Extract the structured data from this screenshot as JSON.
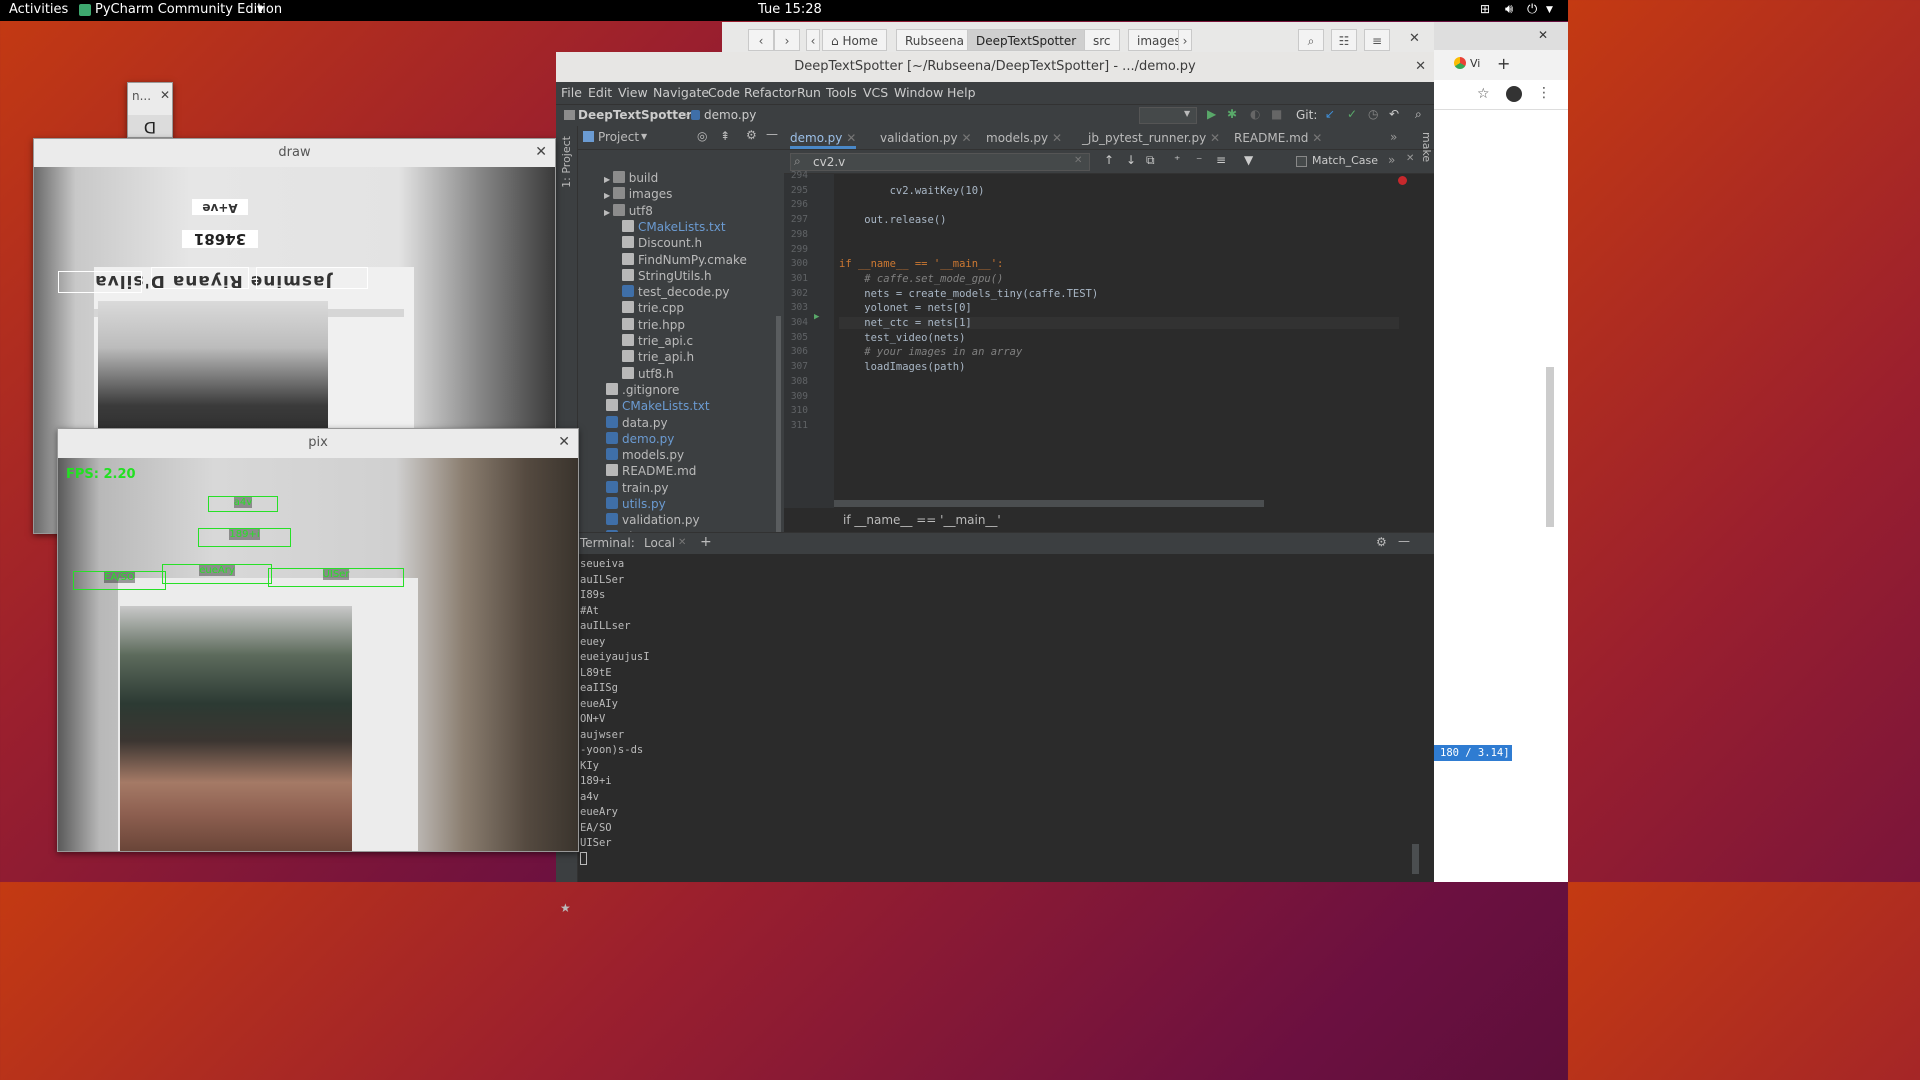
{
  "topbar": {
    "activities": "Activities",
    "app": "PyCharm Community Edition",
    "clock": "Tue 15:28"
  },
  "files": {
    "crumbs": [
      "Home",
      "Rubseena",
      "DeepTextSpotter",
      "src",
      "images"
    ]
  },
  "pycharm": {
    "title": "DeepTextSpotter [~/Rubseena/DeepTextSpotter] - .../demo.py",
    "menu": [
      "File",
      "Edit",
      "View",
      "Navigate",
      "Code",
      "Refactor",
      "Run",
      "Tools",
      "VCS",
      "Window",
      "Help"
    ],
    "nav": {
      "project": "DeepTextSpotter",
      "file": "demo.py",
      "git": "Git:"
    },
    "project_label": "Project",
    "side_label": "1: Project",
    "tree": [
      {
        "label": "build",
        "type": "folder"
      },
      {
        "label": "images",
        "type": "folder"
      },
      {
        "label": "utf8",
        "type": "folder"
      },
      {
        "label": "CMakeLists.txt",
        "type": "txt",
        "blue": true
      },
      {
        "label": "Discount.h",
        "type": "txt"
      },
      {
        "label": "FindNumPy.cmake",
        "type": "txt"
      },
      {
        "label": "StringUtils.h",
        "type": "txt"
      },
      {
        "label": "test_decode.py",
        "type": "py"
      },
      {
        "label": "trie.cpp",
        "type": "txt"
      },
      {
        "label": "trie.hpp",
        "type": "txt"
      },
      {
        "label": "trie_api.c",
        "type": "txt"
      },
      {
        "label": "trie_api.h",
        "type": "txt"
      },
      {
        "label": "utf8.h",
        "type": "txt"
      },
      {
        "label": ".gitignore",
        "type": "txt"
      },
      {
        "label": "CMakeLists.txt",
        "type": "txt",
        "blue": true
      },
      {
        "label": "data.py",
        "type": "py"
      },
      {
        "label": "demo.py",
        "type": "py",
        "blue": true
      },
      {
        "label": "models.py",
        "type": "py"
      },
      {
        "label": "README.md",
        "type": "txt"
      },
      {
        "label": "train.py",
        "type": "py"
      },
      {
        "label": "utils.py",
        "type": "py",
        "blue": true
      },
      {
        "label": "validation.py",
        "type": "py"
      },
      {
        "label": "vis.py",
        "type": "py"
      }
    ],
    "tabs": [
      "demo.py",
      "validation.py",
      "models.py",
      "_jb_pytest_runner.py",
      "README.md"
    ],
    "find": {
      "query": "cv2.v",
      "match_case": "Match_Case"
    },
    "code": [
      {
        "n": "294",
        "t": ""
      },
      {
        "n": "295",
        "t": "        cv2.waitKey(10)"
      },
      {
        "n": "296",
        "t": ""
      },
      {
        "n": "297",
        "t": "    out.release()"
      },
      {
        "n": "298",
        "t": ""
      },
      {
        "n": "299",
        "t": ""
      },
      {
        "n": "300",
        "t": "if __name__ == '__main__':"
      },
      {
        "n": "301",
        "t": "    # caffe.set_mode_gpu()"
      },
      {
        "n": "302",
        "t": "    nets = create_models_tiny(caffe.TEST)"
      },
      {
        "n": "303",
        "t": "    yolonet = nets[0]"
      },
      {
        "n": "304",
        "t": "    net_ctc = nets[1]"
      },
      {
        "n": "305",
        "t": "    test_video(nets)"
      },
      {
        "n": "306",
        "t": "    # your images in an array"
      },
      {
        "n": "307",
        "t": "    loadImages(path)"
      },
      {
        "n": "308",
        "t": ""
      },
      {
        "n": "309",
        "t": ""
      },
      {
        "n": "310",
        "t": ""
      },
      {
        "n": "311",
        "t": ""
      }
    ],
    "breadcrumb_bottom": "if __name__ == '__main__'",
    "terminal": {
      "label": "Terminal:",
      "tab": "Local",
      "lines": [
        "seueiva",
        "auILSer",
        "I89s",
        "#At",
        "auILLser",
        "euey",
        "eueiyaujusI",
        "L89tE",
        "eaIISg",
        "eueAIy",
        "ON+V",
        "aujwser",
        "-yoon)s-ds",
        "KIy",
        "189+i",
        "a4v",
        "eueAry",
        "EA/SO",
        "UISer"
      ]
    }
  },
  "chrome": {
    "status": "180 / 3.14]"
  },
  "windows": {
    "small": {
      "title": "n..."
    },
    "draw": {
      "title": "draw",
      "texts": [
        "A+ve",
        "34681",
        "Jasmine Riyana D'silva"
      ]
    },
    "pix": {
      "title": "pix",
      "fps": "FPS: 2.20",
      "detections": [
        "a4v",
        "189+i",
        "EA/SO",
        "eueAry",
        "UISer"
      ]
    }
  }
}
